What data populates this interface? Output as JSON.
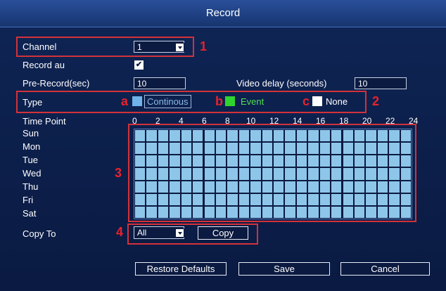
{
  "window": {
    "title": "Record"
  },
  "channel": {
    "label": "Channel",
    "value": "1"
  },
  "record_audio": {
    "label": "Record au",
    "checked": true,
    "mark": "✔"
  },
  "pre_record": {
    "label": "Pre-Record(sec)",
    "value": "10"
  },
  "video_delay": {
    "label": "Video delay (seconds)",
    "value": "10"
  },
  "type": {
    "label": "Type",
    "options": [
      {
        "key": "a",
        "label": "Continous",
        "color": "#6fb3e8"
      },
      {
        "key": "b",
        "label": "Event",
        "color": "#2fd52f"
      },
      {
        "key": "c",
        "label": "None",
        "color": "#ffffff"
      }
    ]
  },
  "schedule": {
    "label": "Time Point",
    "hours": [
      "0",
      "2",
      "4",
      "6",
      "8",
      "10",
      "12",
      "14",
      "16",
      "18",
      "20",
      "22",
      "24"
    ],
    "days": [
      "Sun",
      "Mon",
      "Tue",
      "Wed",
      "Thu",
      "Fri",
      "Sat"
    ],
    "fill_color": "#8ec6ea"
  },
  "copy_to": {
    "label": "Copy To",
    "value": "All",
    "button": "Copy"
  },
  "footer": {
    "restore": "Restore Defaults",
    "save": "Save",
    "cancel": "Cancel"
  },
  "annotations": {
    "n1": "1",
    "n2": "2",
    "n3": "3",
    "n4": "4",
    "accent": "#e8232d"
  }
}
